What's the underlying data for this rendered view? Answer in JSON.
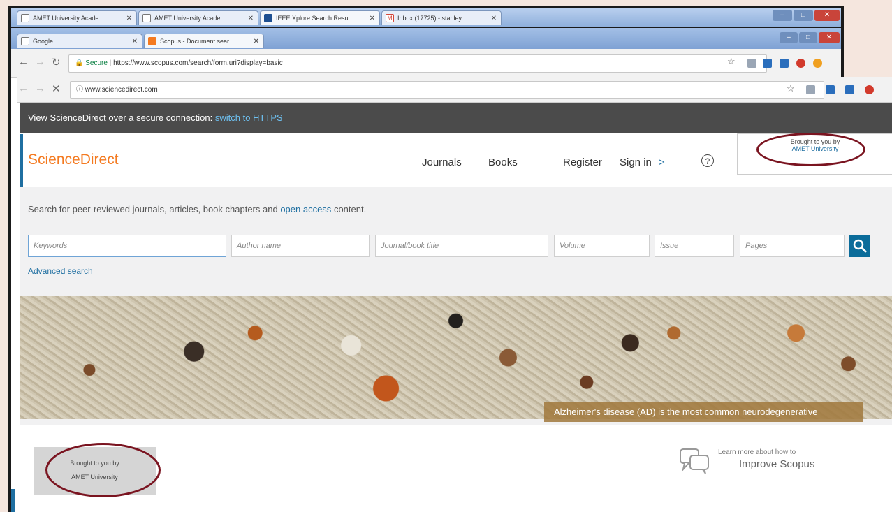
{
  "outer_window": {
    "tabs": [
      {
        "label": "AMET University Acade"
      },
      {
        "label": "AMET University Acade"
      },
      {
        "label": "IEEE Xplore Search Resu"
      },
      {
        "label": "Inbox (17725) - stanley"
      }
    ]
  },
  "scopus_window": {
    "tabs": [
      {
        "label": "Google"
      },
      {
        "label": "Scopus - Document sear"
      }
    ],
    "url_secure": "Secure",
    "url": "https://www.scopus.com/search/form.uri?display=basic"
  },
  "sd_window": {
    "url": "www.sciencedirect.com",
    "https_banner": {
      "text": "View ScienceDirect over a secure connection:",
      "link": "switch to HTTPS"
    },
    "logo": "ScienceDirect",
    "nav": {
      "journals": "Journals",
      "books": "Books",
      "register": "Register",
      "signin": "Sign in",
      "signin_chevron": ">",
      "help": "?"
    },
    "brought_by": {
      "line1": "Brought to you by",
      "line2": "AMET University"
    },
    "search": {
      "lead": "Search for peer-reviewed journals, articles, book chapters and",
      "lead_link": "open access",
      "lead_tail": "content.",
      "fields": {
        "keywords": "Keywords",
        "author": "Author name",
        "journal": "Journal/book title",
        "volume": "Volume",
        "issue": "Issue",
        "pages": "Pages"
      },
      "advanced": "Advanced search"
    },
    "hero_caption": "Alzheimer's disease (AD) is the most common neurodegenerative"
  },
  "scopus_footer": {
    "brought_by": {
      "line1": "Brought to you by",
      "line2": "AMET University"
    },
    "improve": {
      "line1": "Learn more about how to",
      "line2": "Improve Scopus"
    }
  },
  "colors": {
    "accent_blue": "#0b6c9a",
    "sd_orange": "#f47a20",
    "annotation_ring": "#7a1420"
  }
}
